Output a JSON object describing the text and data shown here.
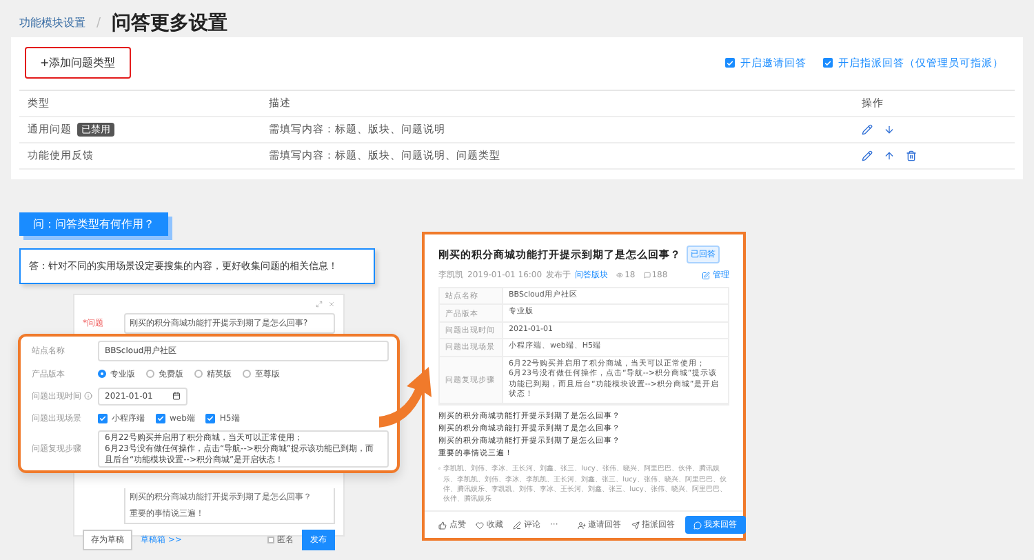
{
  "breadcrumb": {
    "parent": "功能模块设置",
    "separator": "/",
    "current": "问答更多设置"
  },
  "toolbar": {
    "add_button": "+添加问题类型",
    "options": [
      {
        "label": "开启邀请回答",
        "checked": true
      },
      {
        "label": "开启指派回答（仅管理员可指派）",
        "checked": true
      }
    ]
  },
  "table": {
    "columns": [
      "类型",
      "描述",
      "操作"
    ],
    "rows": [
      {
        "type": "通用问题",
        "tag": "已禁用",
        "description": "需填写内容：标题、版块、问题说明",
        "actions": [
          {
            "kind": "edit"
          },
          {
            "kind": "down"
          }
        ]
      },
      {
        "type": "功能使用反馈",
        "description": "需填写内容：标题、版块、问题说明、问题类型",
        "actions": [
          {
            "kind": "edit"
          },
          {
            "kind": "up"
          },
          {
            "kind": "delete"
          }
        ]
      }
    ]
  },
  "faq": {
    "question": "问：问答类型有何作用？",
    "answer": "答：针对不同的实用场景设定要搜集的内容，更好收集问题的相关信息！"
  },
  "editor_mockup": {
    "title_label": "*问题",
    "title_value": "刚买的积分商城功能打开提示到期了是怎么回事?",
    "body_lines": [
      "刚买的积分商城功能打开提示到期了是怎么回事？",
      "重要的事情说三遍！"
    ],
    "draft_button": "存为草稿",
    "drafts_link": "草稿箱 >>",
    "anonymous": {
      "label": "匿名",
      "checked": false
    },
    "publish_button": "发布"
  },
  "form_mockup": {
    "fields": [
      {
        "kind": "text",
        "label": "站点名称",
        "value": "BBScloud用户社区"
      },
      {
        "kind": "radio",
        "label": "产品版本",
        "options": [
          {
            "label": "专业版",
            "selected": true
          },
          {
            "label": "免费版",
            "selected": false
          },
          {
            "label": "精英版",
            "selected": false
          },
          {
            "label": "至尊版",
            "selected": false
          }
        ]
      },
      {
        "kind": "date",
        "label": "问题出现时间",
        "value": "2021-01-01"
      },
      {
        "kind": "checkbox",
        "label": "问题出现场景",
        "options": [
          {
            "label": "小程序端",
            "checked": true
          },
          {
            "label": "web端",
            "checked": true
          },
          {
            "label": "H5端",
            "checked": true
          }
        ]
      },
      {
        "kind": "textarea",
        "label": "问题复现步骤",
        "value": "6月22号购买并启用了积分商城，当天可以正常使用；\n6月23号没有做任何操作，点击“导航-->积分商城”提示该功能已到期，而且后台“功能模块设置-->积分商城”是开启状态！"
      }
    ]
  },
  "post_mockup": {
    "title": "刚买的积分商城功能打开提示到期了是怎么回事？",
    "status": "已回答",
    "meta": {
      "author": "李凯凯",
      "time": "2019-01-01 16:00",
      "posted_in": "发布于",
      "board": "问答版块",
      "views": "18",
      "comments": "188"
    },
    "manage": "管理",
    "info_rows": [
      {
        "label": "站点名称",
        "value": "BBScloud用户社区"
      },
      {
        "label": "产品版本",
        "value": "专业版"
      },
      {
        "label": "问题出现时间",
        "value": "2021-01-01"
      },
      {
        "label": "问题出现场景",
        "value": "小程序端、web端、H5端"
      },
      {
        "label": "问题复现步骤",
        "value": "6月22号购买并启用了积分商城，当天可以正常使用；\n6月23号没有做任何操作，点击“导航-->积分商城”提示该功能已到期，而且后台“功能模块设置-->积分商城”是开启状态！"
      }
    ],
    "body_lines": [
      "刚买的积分商城功能打开提示到期了是怎么回事？",
      "刚买的积分商城功能打开提示到期了是怎么回事？",
      "刚买的积分商城功能打开提示到期了是怎么回事？",
      "重要的事情说三遍！"
    ],
    "likers": "李凯凯、刘伟、李冰、王长河、刘鑫、张三、lucy、张伟、晓兴、阿里巴巴、伙伴、腾讯娱乐、李凯凯、刘伟、李冰、李凯凯、王长河、刘鑫、张三、lucy、张伟、晓兴、阿里巴巴、伙伴、腾讯娱乐、李凯凯、刘伟、李冰、王长河、刘鑫、张三、lucy、张伟、晓兴、阿里巴巴、伙伴、腾讯娱乐",
    "actions": [
      {
        "kind": "like",
        "label": "点赞"
      },
      {
        "kind": "favorite",
        "label": "收藏"
      },
      {
        "kind": "comment",
        "label": "评论"
      },
      {
        "kind": "more",
        "label": "···"
      }
    ],
    "right_actions": [
      {
        "kind": "invite",
        "label": "邀请回答"
      },
      {
        "kind": "assign",
        "label": "指派回答"
      },
      {
        "kind": "answer",
        "label": "我来回答"
      }
    ]
  }
}
